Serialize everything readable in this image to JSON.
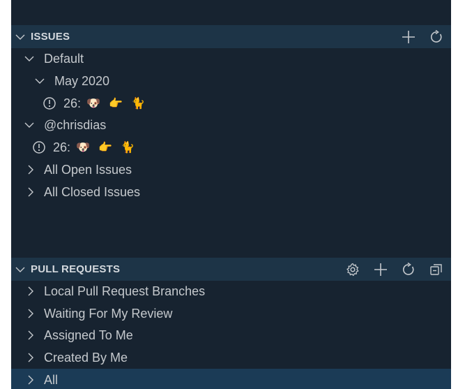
{
  "issues": {
    "header": "ISSUES",
    "default_group": "Default",
    "milestone": "May 2020",
    "issue_number_1": "26:",
    "user_group": "@chrisdias",
    "issue_number_2": "26:",
    "all_open": "All Open Issues",
    "all_closed": "All Closed Issues",
    "emojis": [
      "🐶",
      "👉",
      "🐈"
    ]
  },
  "pull_requests": {
    "header": "PULL REQUESTS",
    "items": [
      {
        "label": "Local Pull Request Branches"
      },
      {
        "label": "Waiting For My Review"
      },
      {
        "label": "Assigned To Me"
      },
      {
        "label": "Created By Me"
      },
      {
        "label": "All"
      }
    ]
  },
  "colors": {
    "sidebar_bg": "#172330",
    "header_bg": "#1d3447",
    "selected_bg": "#1b3b56",
    "text": "#c5c9cd"
  }
}
